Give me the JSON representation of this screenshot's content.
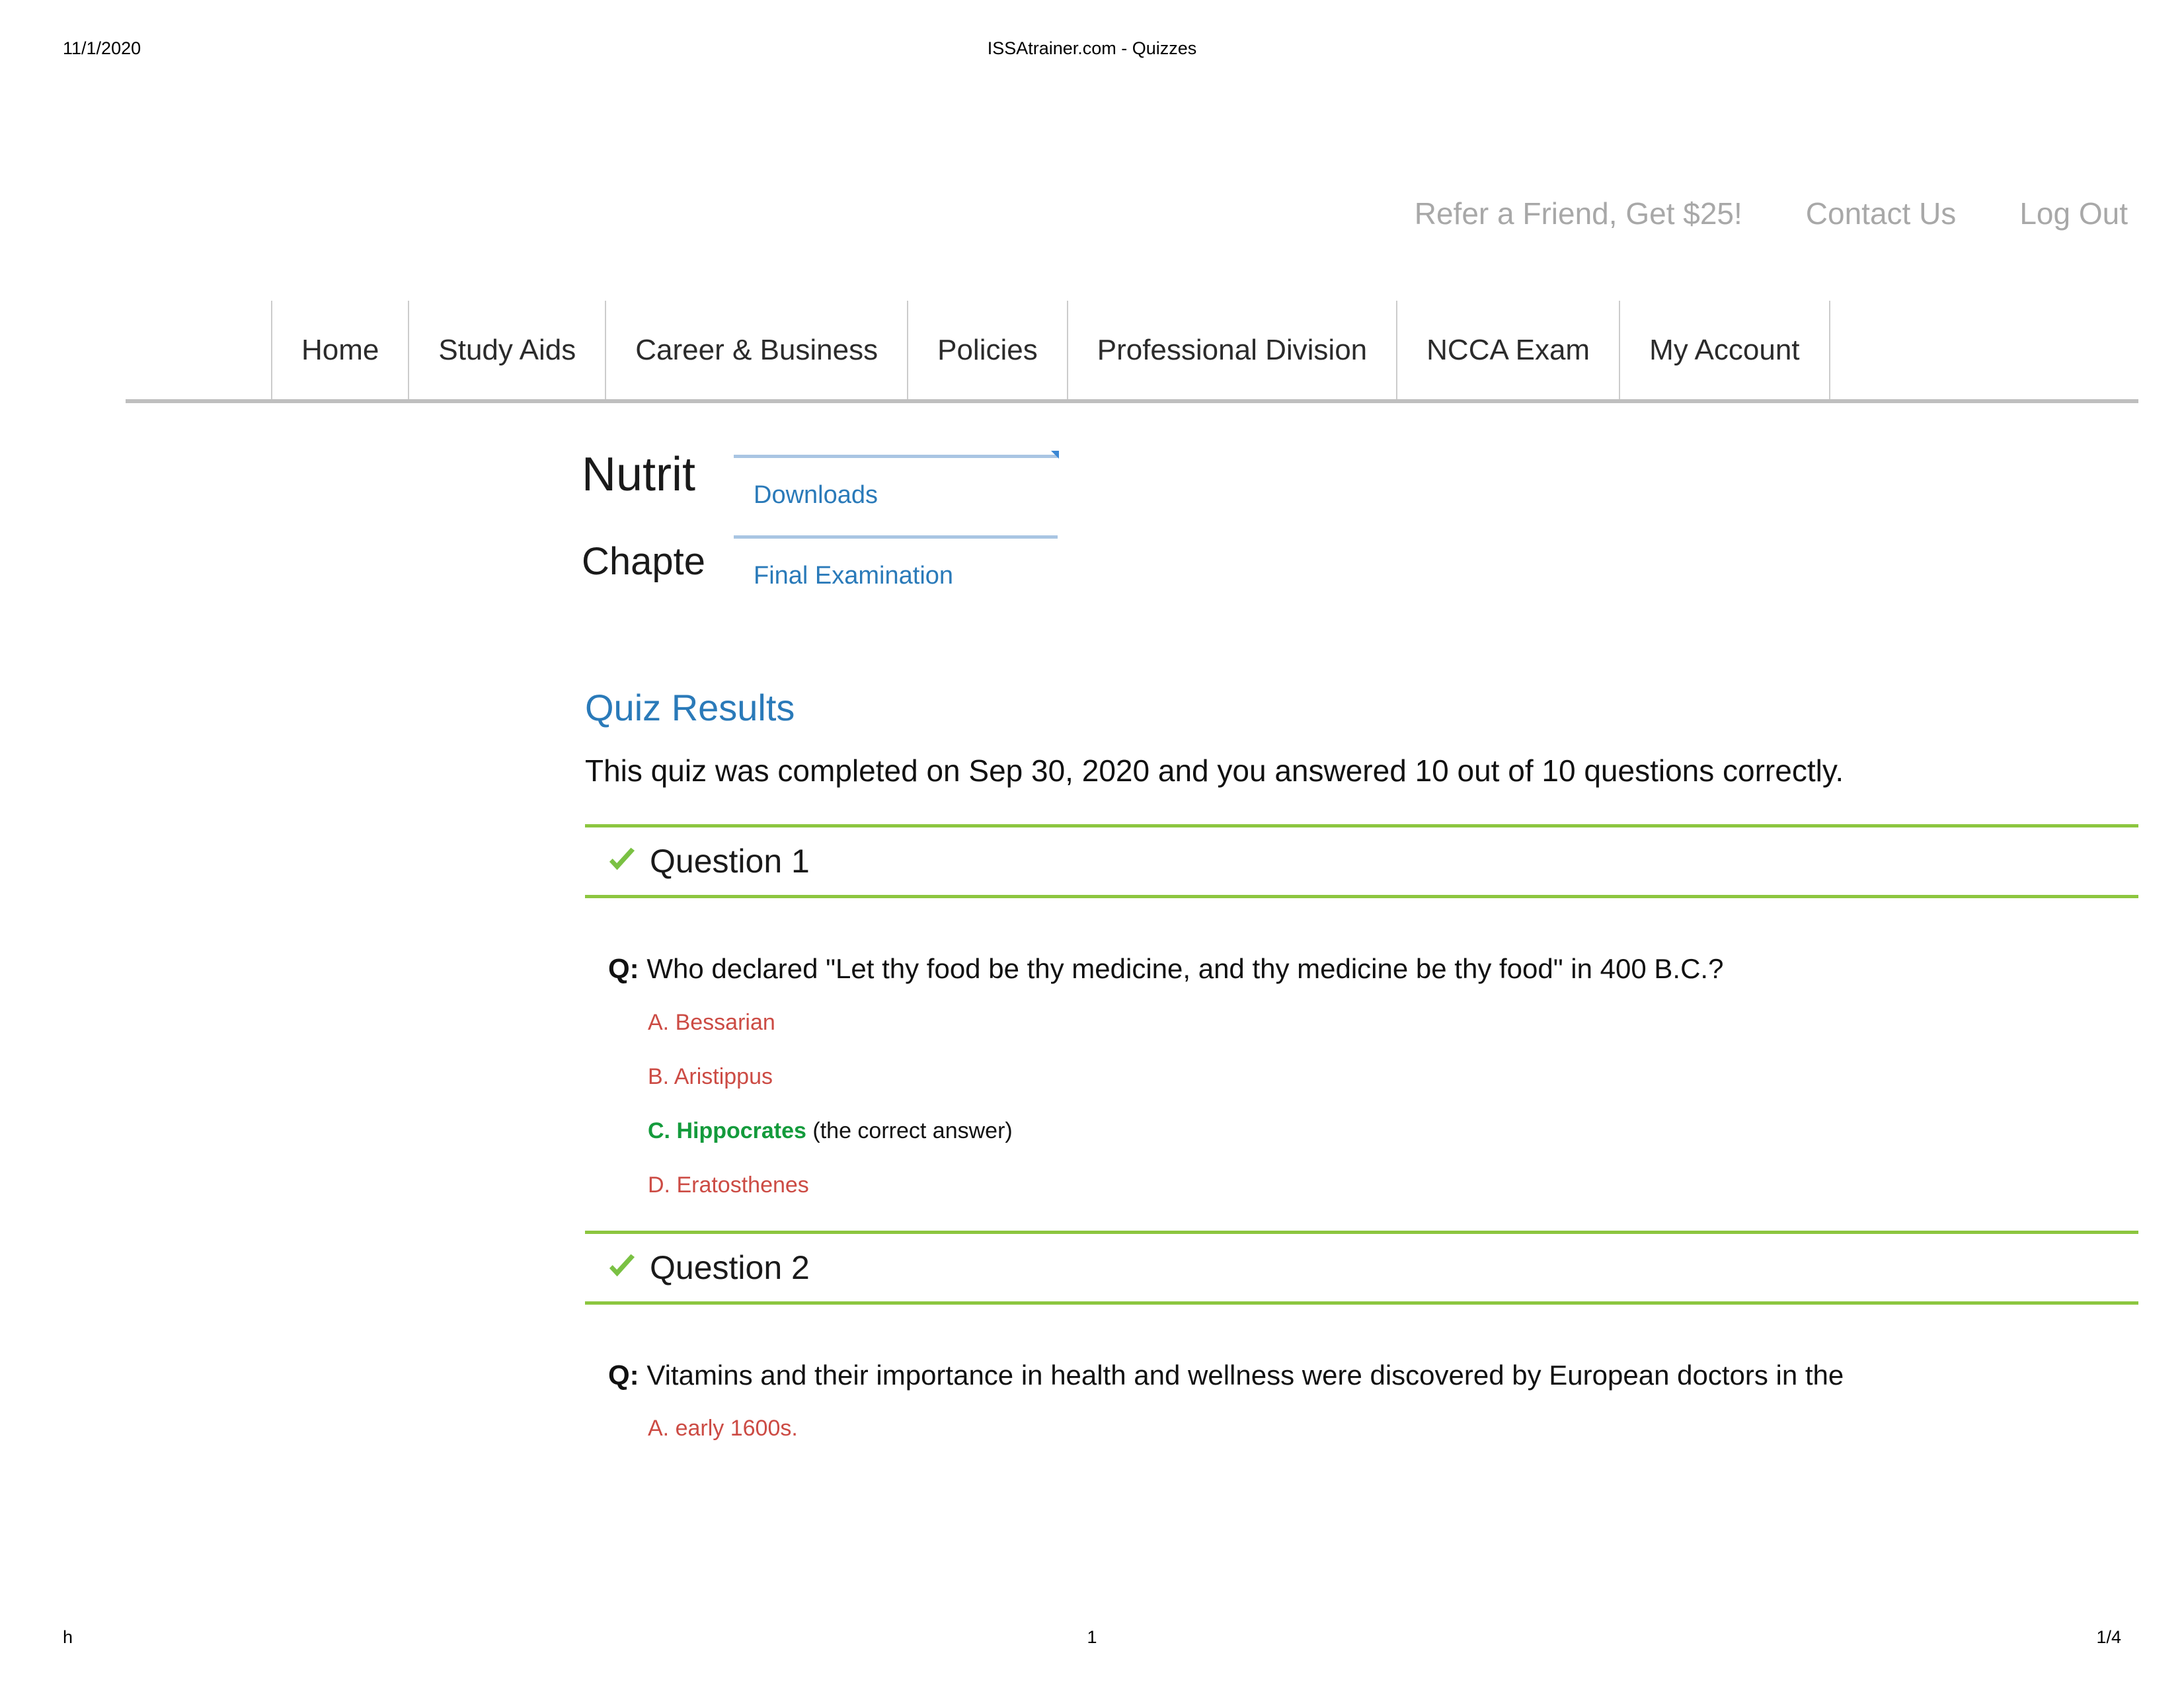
{
  "print_header": {
    "date": "11/1/2020",
    "title": "ISSAtrainer.com - Quizzes"
  },
  "utility_bar": {
    "links": [
      {
        "label": "Refer a Friend, Get $25!",
        "name": "refer-a-friend-link"
      },
      {
        "label": "Contact Us",
        "name": "contact-us-link"
      },
      {
        "label": "Log Out",
        "name": "log-out-link"
      }
    ]
  },
  "main_nav": {
    "items": [
      {
        "label": "Home"
      },
      {
        "label": "Study Aids"
      },
      {
        "label": "Career & Business"
      },
      {
        "label": "Policies"
      },
      {
        "label": "Professional Division"
      },
      {
        "label": "NCCA Exam"
      },
      {
        "label": "My Account"
      }
    ]
  },
  "page_heading": {
    "line1": "Nutrit",
    "line2": "Chapte"
  },
  "dropdown": {
    "items": [
      {
        "label": "Downloads"
      },
      {
        "label": "Final Examination"
      }
    ]
  },
  "content": {
    "title": "Quiz Results",
    "summary": "This quiz was completed on Sep 30, 2020 and you answered 10 out of 10 questions correctly.",
    "questions": [
      {
        "label": "Question 1",
        "q_marker": "Q:",
        "text": "Who declared \"Let thy food be thy medicine, and thy medicine be thy food\" in 400 B.C.?",
        "answers": [
          {
            "text": "A. Bessarian",
            "correct": false,
            "note": ""
          },
          {
            "text": "B. Aristippus",
            "correct": false,
            "note": ""
          },
          {
            "text": "C. Hippocrates",
            "correct": true,
            "note": " (the correct answer)"
          },
          {
            "text": "D. Eratosthenes",
            "correct": false,
            "note": ""
          }
        ]
      },
      {
        "label": "Question 2",
        "q_marker": "Q:",
        "text": "Vitamins and their importance in health and wellness were discovered by European doctors in the",
        "answers": [
          {
            "text": "A. early 1600s.",
            "correct": false,
            "note": ""
          }
        ]
      }
    ]
  },
  "print_footer": {
    "left": "h",
    "center": "1",
    "right": "1/4"
  },
  "colors": {
    "link_blue": "#2a7ab9",
    "correct_green": "#149b3c",
    "rule_green": "#8cc63f",
    "wrong_red": "#cc4b44",
    "utility_gray": "#a8a8a8"
  }
}
